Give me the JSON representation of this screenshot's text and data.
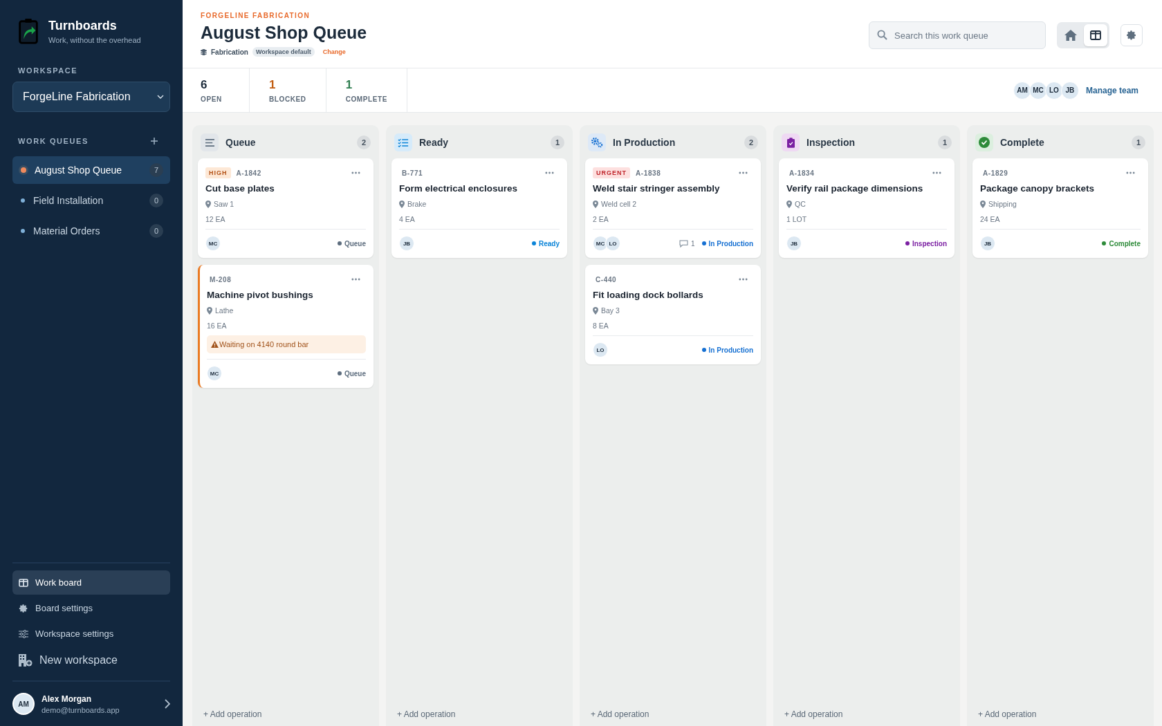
{
  "sidebar": {
    "brand": "Turnboards",
    "tagline": "Work, without the overhead",
    "workspace_label": "WORKSPACE",
    "workspace": "ForgeLine Fabrication",
    "queues_label": "WORK QUEUES",
    "queues": [
      {
        "name": "August Shop Queue",
        "count": "7",
        "selected": true,
        "color": "#f08a5d"
      },
      {
        "name": "Field Installation",
        "count": "0",
        "selected": false,
        "color": "#7fb0d8"
      },
      {
        "name": "Material Orders",
        "count": "0",
        "selected": false,
        "color": "#7fb0d8"
      }
    ],
    "nav": [
      {
        "label": "Work board",
        "kind": "board",
        "selected": true
      },
      {
        "label": "Board settings",
        "kind": "gear",
        "selected": false
      },
      {
        "label": "Workspace settings",
        "kind": "sliders",
        "selected": false
      },
      {
        "label": "New workspace",
        "kind": "building",
        "selected": false
      }
    ],
    "user": {
      "initials": "AM",
      "name": "Alex Morgan",
      "email": "demo@turnboards.app"
    }
  },
  "header": {
    "org": "FORGELINE FABRICATION",
    "title": "August Shop Queue",
    "category": "Fabrication",
    "badge": "Workspace default",
    "change": "Change",
    "search": {
      "placeholder": "Search this work queue"
    },
    "views": [
      {
        "kind": "home",
        "selected": false
      },
      {
        "kind": "board",
        "selected": true
      }
    ]
  },
  "stats": [
    {
      "value": "6",
      "label": "OPEN",
      "color": "#1b2a3a"
    },
    {
      "value": "1",
      "label": "BLOCKED",
      "color": "#c25e12"
    },
    {
      "value": "1",
      "label": "COMPLETE",
      "color": "#2e7d4f"
    }
  ],
  "team": {
    "members": [
      "AM",
      "MC",
      "LO",
      "JB"
    ],
    "manage": "Manage team"
  },
  "columns": [
    {
      "title": "Queue",
      "count": "2",
      "kind": "queue",
      "color": "#5d6d7e",
      "add": "+ Add operation",
      "cards": [
        {
          "priority": {
            "label": "HIGH",
            "kind": "high"
          },
          "id": "A-1842",
          "title": "Cut base plates",
          "location": "Saw 1",
          "quantity": "12 EA",
          "assignees": [
            "MC"
          ],
          "status": "Queue",
          "blocked": false
        },
        {
          "id": "M-208",
          "title": "Machine pivot bushings",
          "location": "Lathe",
          "quantity": "16 EA",
          "warning": "Waiting on 4140 round bar",
          "assignees": [
            "MC"
          ],
          "status": "Queue",
          "blocked": true
        }
      ]
    },
    {
      "title": "Ready",
      "count": "1",
      "kind": "ready",
      "color": "#0b84d8",
      "add": "+ Add operation",
      "cards": [
        {
          "id": "B-771",
          "title": "Form electrical enclosures",
          "location": "Brake",
          "quantity": "4 EA",
          "assignees": [
            "JB"
          ],
          "status": "Ready",
          "blocked": false
        }
      ]
    },
    {
      "title": "In Production",
      "count": "2",
      "kind": "production",
      "color": "#1670d2",
      "add": "+ Add operation",
      "cards": [
        {
          "priority": {
            "label": "URGENT",
            "kind": "urgent"
          },
          "id": "A-1838",
          "title": "Weld stair stringer assembly",
          "location": "Weld cell 2",
          "quantity": "2 EA",
          "assignees": [
            "MC",
            "LO"
          ],
          "comments": "1",
          "status": "In Production",
          "blocked": false
        },
        {
          "id": "C-440",
          "title": "Fit loading dock bollards",
          "location": "Bay 3",
          "quantity": "8 EA",
          "assignees": [
            "LO"
          ],
          "status": "In Production",
          "blocked": false
        }
      ]
    },
    {
      "title": "Inspection",
      "count": "1",
      "kind": "inspection",
      "color": "#7b1fa2",
      "add": "+ Add operation",
      "cards": [
        {
          "id": "A-1834",
          "title": "Verify rail package dimensions",
          "location": "QC",
          "quantity": "1 LOT",
          "assignees": [
            "JB"
          ],
          "status": "Inspection",
          "blocked": false
        }
      ]
    },
    {
      "title": "Complete",
      "count": "1",
      "kind": "complete",
      "color": "#2e8b3a",
      "add": "+ Add operation",
      "cards": [
        {
          "id": "A-1829",
          "title": "Package canopy brackets",
          "location": "Shipping",
          "quantity": "24 EA",
          "assignees": [
            "JB"
          ],
          "status": "Complete",
          "blocked": false
        }
      ]
    }
  ]
}
